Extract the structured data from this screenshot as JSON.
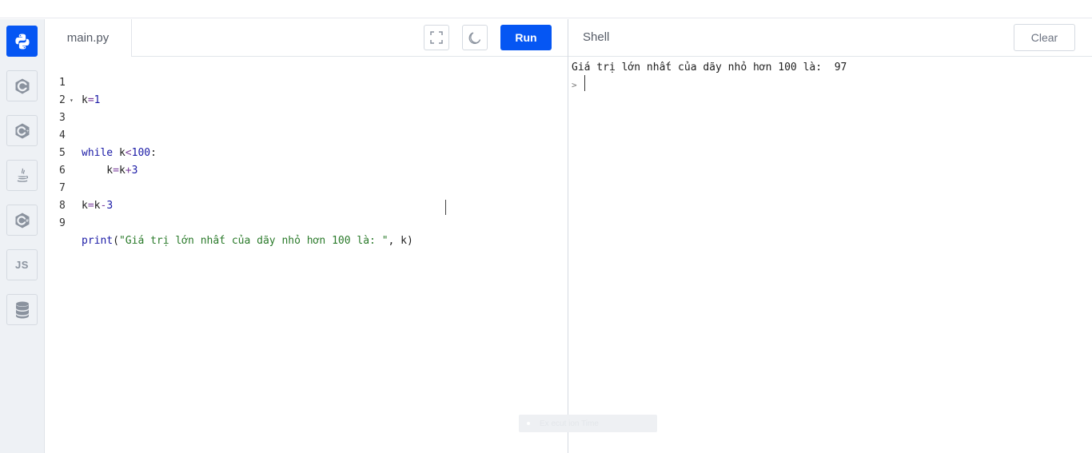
{
  "sidebar": {
    "items": [
      {
        "icon": "python-icon",
        "active": true
      },
      {
        "icon": "c-icon",
        "active": false
      },
      {
        "icon": "cpp-icon",
        "active": false
      },
      {
        "icon": "java-icon",
        "active": false
      },
      {
        "icon": "csharp-icon",
        "active": false
      },
      {
        "icon": "js-icon",
        "label": "JS",
        "active": false
      },
      {
        "icon": "database-icon",
        "active": false
      }
    ]
  },
  "editor": {
    "tab_label": "main.py",
    "fullscreen_icon": "fullscreen-icon",
    "theme_icon": "moon-icon",
    "run_label": "Run",
    "lines": [
      {
        "num": "1",
        "code": "k=1"
      },
      {
        "num": "2",
        "code": ""
      },
      {
        "num": "3",
        "code": "while k<100:",
        "fold": "▾"
      },
      {
        "num": "4",
        "code": ""
      },
      {
        "num": "5",
        "code": "    k=k+3"
      },
      {
        "num": "6",
        "code": ""
      },
      {
        "num": "7",
        "code": "k=k-3"
      },
      {
        "num": "8",
        "code": ""
      },
      {
        "num": "9",
        "code": "print(\"Giá trị lớn nhất của dãy nhỏ hơn 100 là: \", k)"
      }
    ]
  },
  "shell": {
    "title": "Shell",
    "clear_label": "Clear",
    "output": "Giá trị lớn nhất của dãy nhỏ hơn 100 là:  97",
    "prompt": ">"
  },
  "toast": {
    "text": "Ex ecut ion Time"
  },
  "colors": {
    "accent": "#0556f3",
    "sidebar_bg": "#eef1f5",
    "keyword": "#1a1aa6",
    "string": "#2a7a2a"
  }
}
